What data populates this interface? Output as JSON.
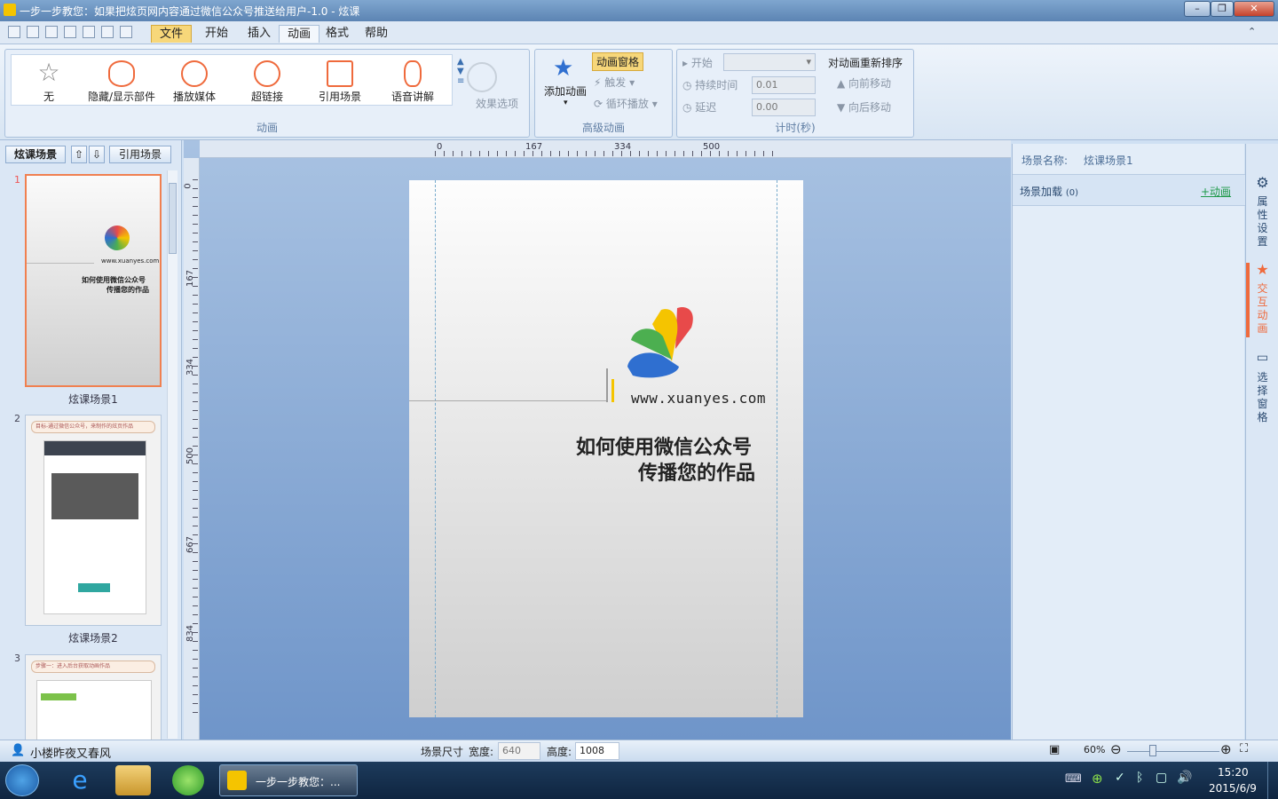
{
  "window": {
    "title": "一步一步教您：如果把炫页网内容通过微信公众号推送给用户-1.0 - 炫课"
  },
  "menu": {
    "items": [
      "文件",
      "开始",
      "插入",
      "动画",
      "格式",
      "帮助"
    ]
  },
  "ribbon": {
    "gallery": [
      "无",
      "隐藏/显示部件",
      "播放媒体",
      "超链接",
      "引用场景",
      "语音讲解"
    ],
    "effect_options": "效果选项",
    "group1_label": "动画",
    "add_animation": "添加动画",
    "animation_pane": "动画窗格",
    "trigger": "触发",
    "loop": "循环播放",
    "group2_label": "高级动画",
    "start_label": "开始",
    "duration_label": "持续时间",
    "duration_value": "0.01",
    "delay_label": "延迟",
    "delay_value": "0.00",
    "reorder": "对动画重新排序",
    "move_earlier": "向前移动",
    "move_later": "向后移动",
    "group3_label": "计时(秒)"
  },
  "left_panel": {
    "tab": "炫课场景",
    "ref_scene": "引用场景",
    "scenes": [
      {
        "num": "1",
        "label": "炫课场景1",
        "line1": "如何使用微信公众号",
        "line2": "传播您的作品",
        "url": "www.xuanyes.com"
      },
      {
        "num": "2",
        "label": "炫课场景2",
        "caption": "目标-通过微信公众号，来制作的炫页作品"
      },
      {
        "num": "3",
        "caption": "步骤一：进入后台获取动画作品"
      }
    ]
  },
  "ruler": {
    "top": [
      "0",
      "167",
      "334",
      "500"
    ],
    "left": [
      "0",
      "167",
      "334",
      "500",
      "667",
      "834"
    ]
  },
  "page": {
    "url": "www.xuanyes.com",
    "line1": "如何使用微信公众号",
    "line2": "传播您的作品"
  },
  "right_panel": {
    "scene_name_label": "场景名称:",
    "scene_name_value": "炫课场景1",
    "scene_load": "场景加载",
    "scene_load_count": "(0)",
    "add_anim": "+动画"
  },
  "right_bar": [
    "属性设置",
    "交互动画",
    "选择窗格"
  ],
  "status": {
    "user": "小楼昨夜又春风",
    "scene_size": "场景尺寸",
    "width_label": "宽度:",
    "width_value": "640",
    "height_label": "高度:",
    "height_value": "1008",
    "zoom": "60%"
  },
  "taskbar": {
    "app_label": "一步一步教您：...",
    "time": "15:20",
    "date": "2015/6/9"
  }
}
